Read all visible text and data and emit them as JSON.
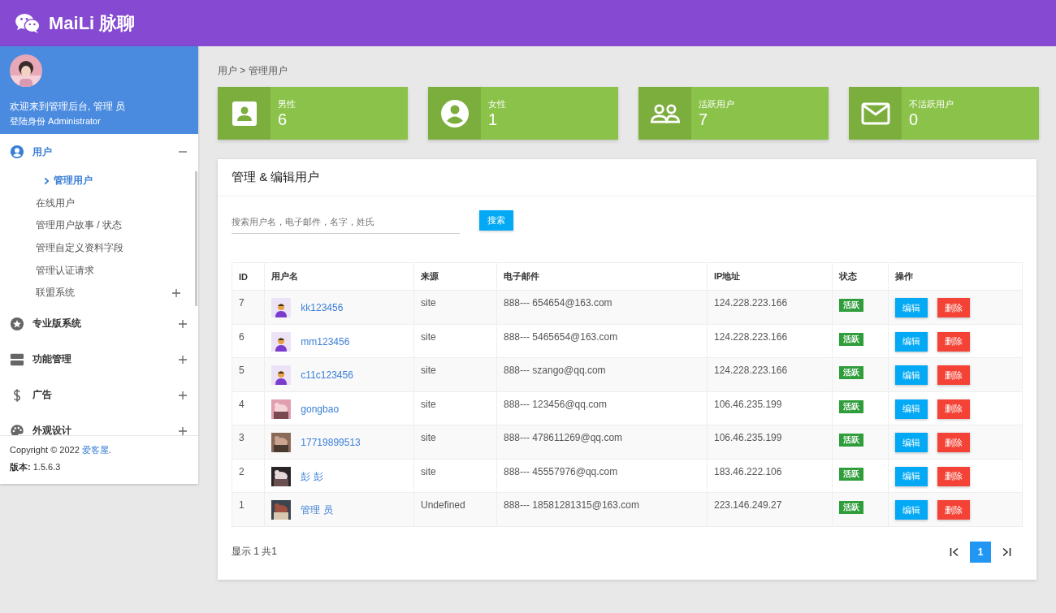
{
  "app": {
    "title": "MaiLi 脉聊"
  },
  "sidebar": {
    "welcome": "欢迎来到管理后台, 管理 员",
    "role": "登陆身份 Administrator",
    "menu": [
      {
        "label": "用户",
        "expanded": true,
        "children": [
          {
            "label": "管理用户",
            "kind": "link",
            "selected": true
          },
          {
            "label": "在线用户",
            "kind": "link",
            "selected": false
          },
          {
            "label": "管理用户故事 / 状态",
            "kind": "link",
            "selected": false
          },
          {
            "label": "管理自定义资料字段",
            "kind": "link",
            "selected": false
          },
          {
            "label": "管理认证请求",
            "kind": "link",
            "selected": false
          },
          {
            "label": "联盟系统",
            "kind": "group",
            "selected": false,
            "expanded": false
          }
        ]
      },
      {
        "label": "专业版系统",
        "expanded": false
      },
      {
        "label": "功能管理",
        "expanded": false
      },
      {
        "label": "广告",
        "expanded": false
      },
      {
        "label": "外观设计",
        "expanded": false
      }
    ],
    "copyright": "Copyright © 2022 ",
    "copyright_link": "爱客屋",
    "copyright_end": ".",
    "version": "**版本:** 1.5.6.3"
  },
  "breadcrumb": "用户 > 管理用户",
  "stats": [
    {
      "label": "男性",
      "value": "6"
    },
    {
      "label": "女性",
      "value": "1"
    },
    {
      "label": "活跃用户",
      "value": "7"
    },
    {
      "label": "不活跃用户",
      "value": "0"
    }
  ],
  "panel": {
    "title": "管理 & 编辑用户",
    "search": {
      "placeholder": "搜索用户名，电子邮件，名字，姓氏"
    },
    "search_button": "搜索",
    "table": {
      "columns": [
        "ID",
        "用户名",
        "来源",
        "电子邮件",
        "IP地址",
        "状态",
        "操作"
      ],
      "rows": [
        {
          "id": "7",
          "kind": "default",
          "username": "kk123456",
          "source": "site",
          "email": "888--- 654654@163.com",
          "ip": "124.228.223.166",
          "status": "活跃",
          "edit": "编辑",
          "delete": "删除"
        },
        {
          "id": "6",
          "kind": "default",
          "username": "mm123456",
          "source": "site",
          "email": "888--- 5465654@163.com",
          "ip": "124.228.223.166",
          "status": "活跃",
          "edit": "编辑",
          "delete": "删除"
        },
        {
          "id": "5",
          "kind": "default",
          "username": "c11c123456",
          "source": "site",
          "email": "888--- szango@qq.com",
          "ip": "124.228.223.166",
          "status": "活跃",
          "edit": "编辑",
          "delete": "删除"
        },
        {
          "id": "4",
          "username": "gongbao",
          "source": "site",
          "email": "888--- 123456@qq.com",
          "ip": "106.46.235.199",
          "status": "活跃",
          "edit": "编辑",
          "delete": "删除"
        },
        {
          "id": "3",
          "username": "17719899513",
          "source": "site",
          "email": "888--- 478611269@qq.com",
          "ip": "106.46.235.199",
          "status": "活跃",
          "edit": "编辑",
          "delete": "删除"
        },
        {
          "id": "2",
          "username": "彭 彭",
          "source": "site",
          "email": "888--- 45557976@qq.com",
          "ip": "183.46.222.106",
          "status": "活跃",
          "edit": "编辑",
          "delete": "删除"
        },
        {
          "id": "1",
          "username": "管理 员",
          "source": "Undefined",
          "email": "888--- 18581281315@163.com",
          "ip": "223.146.249.27",
          "status": "活跃",
          "edit": "编辑",
          "delete": "删除"
        }
      ]
    },
    "summary": "显示 1 共1",
    "pagination": [
      {
        "kind": "first"
      },
      {
        "kind": "page",
        "label": "1",
        "selected": true
      },
      {
        "kind": "last"
      }
    ]
  }
}
